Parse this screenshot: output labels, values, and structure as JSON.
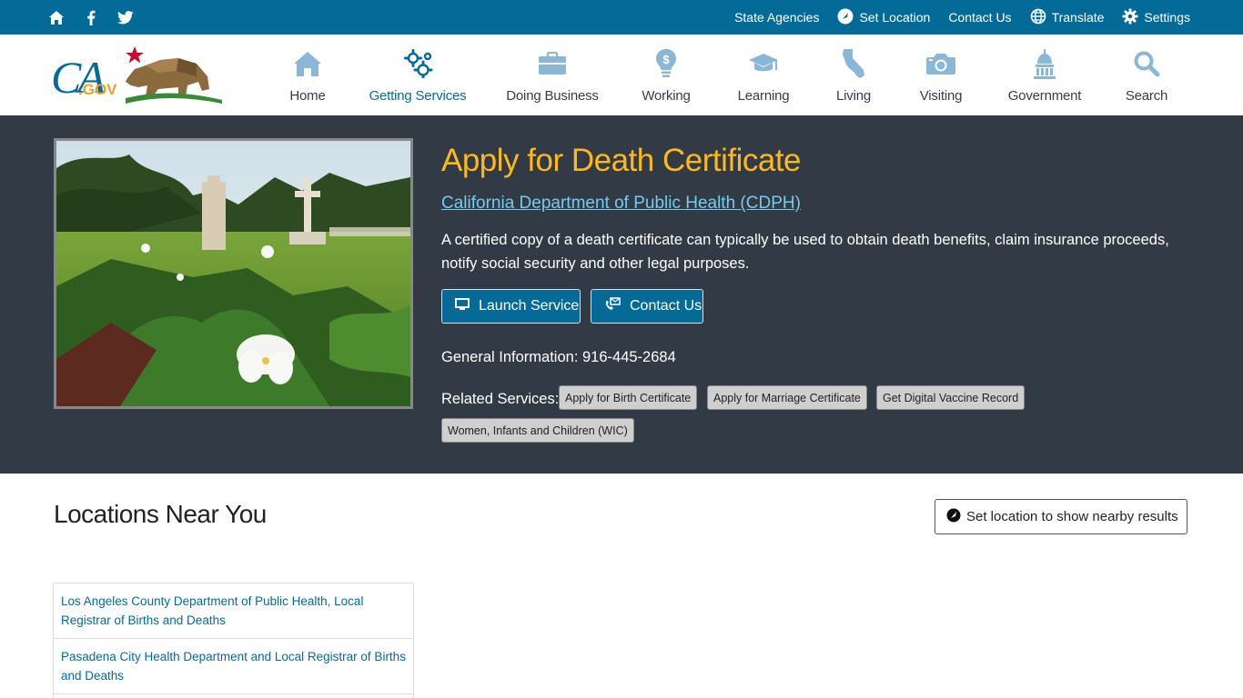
{
  "utility": {
    "state_agencies": "State Agencies",
    "set_location": "Set Location",
    "contact_us": "Contact Us",
    "translate": "Translate",
    "settings": "Settings"
  },
  "nav": {
    "items": [
      {
        "label": "Home",
        "icon": "home-icon"
      },
      {
        "label": "Getting Services",
        "icon": "gears-icon"
      },
      {
        "label": "Doing Business",
        "icon": "briefcase-icon"
      },
      {
        "label": "Working",
        "icon": "lightbulb-dollar-icon"
      },
      {
        "label": "Learning",
        "icon": "graduation-cap-icon"
      },
      {
        "label": "Living",
        "icon": "california-icon"
      },
      {
        "label": "Visiting",
        "icon": "camera-icon"
      },
      {
        "label": "Government",
        "icon": "capitol-icon"
      },
      {
        "label": "Search",
        "icon": "search-icon"
      }
    ],
    "active": "Getting Services"
  },
  "logo": {
    "text_ca": "CA",
    "text_gov": ".GOV"
  },
  "hero": {
    "title": "Apply for Death Certificate",
    "department": "California Department of Public Health (CDPH)",
    "description": "A certified copy of a death certificate can typically be used to obtain death benefits, claim insurance proceeds, notify social security and other legal purposes.",
    "launch_label": "Launch Service",
    "contact_label": "Contact Us",
    "general_info": "General Information: 916-445-2684",
    "related_label": "Related Services:",
    "related": [
      "Apply for Birth Certificate",
      "Apply for Marriage Certificate",
      "Get Digital Vaccine Record",
      "Women, Infants and Children (WIC)"
    ]
  },
  "locations": {
    "title": "Locations Near You",
    "set_location_label": "Set location to show nearby results",
    "items": [
      "Los Angeles County Department of Public Health, Local Registrar of Births and Deaths",
      "Pasadena City Health Department and Local Registrar of Births and Deaths"
    ]
  },
  "colors": {
    "utility_bar": "#046b99",
    "hero_bg": "#323a45",
    "title": "#fdb81e",
    "link": "#72ccee",
    "nav_icon": "#8ab7d6",
    "nav_active": "#046b99"
  }
}
